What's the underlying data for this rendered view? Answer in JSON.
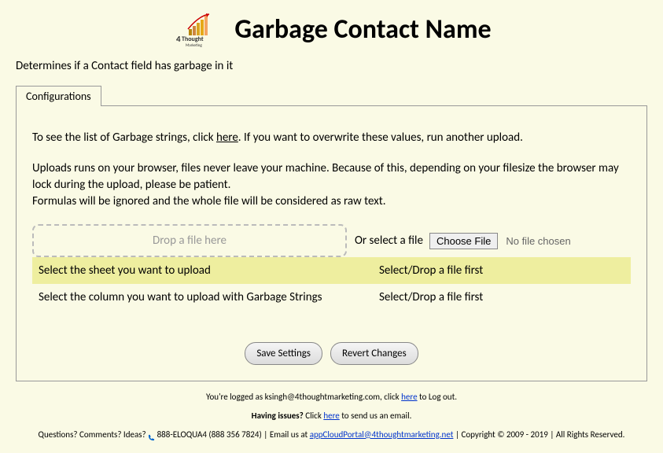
{
  "header": {
    "title": "Garbage Contact Name",
    "logo_text_top": "Thought",
    "logo_text_bottom": "Marketing",
    "logo_number": "4"
  },
  "subtitle": "Determines if a Contact field has garbage in it",
  "tab": {
    "label": "Configurations"
  },
  "content": {
    "instruction1_pre": "To see the list of Garbage strings, click ",
    "instruction1_link": "here",
    "instruction1_post": ". If you want to overwrite these values, run another upload.",
    "instruction2": "Uploads runs on your browser, files never leave your machine. Because of this, depending on your filesize the browser may lock during the upload, please be patient.",
    "instruction3": "Formulas will be ignored and the whole file will be considered as raw text.",
    "dropzone_text": "Drop a file here",
    "or_text": "Or select a file",
    "choose_file_label": "Choose File",
    "file_status": "No file chosen",
    "sheet_label": "Select the sheet you want to upload",
    "sheet_value": "Select/Drop a file first",
    "column_label": "Select the column you want to upload with Garbage Strings",
    "column_value": "Select/Drop a file first",
    "save_button": "Save Settings",
    "revert_button": "Revert Changes"
  },
  "footer": {
    "logged_pre": "You're logged as ksingh@4thoughtmarketing.com, click ",
    "logged_link": "here",
    "logged_post": " to Log out.",
    "issues_pre": "Having issues?",
    "issues_mid": " Click ",
    "issues_link": "here",
    "issues_post": " to send us an email.",
    "questions_pre": "Questions? Comments? Ideas? ",
    "phone": " 888-ELOQUA4 (888 356 7824)",
    "email_pre": " | Email us at ",
    "email_link": "appCloudPortal@4thoughtmarketing.net",
    "copyright": " | Copyright © 2009 - 2019 | All Rights Reserved."
  }
}
